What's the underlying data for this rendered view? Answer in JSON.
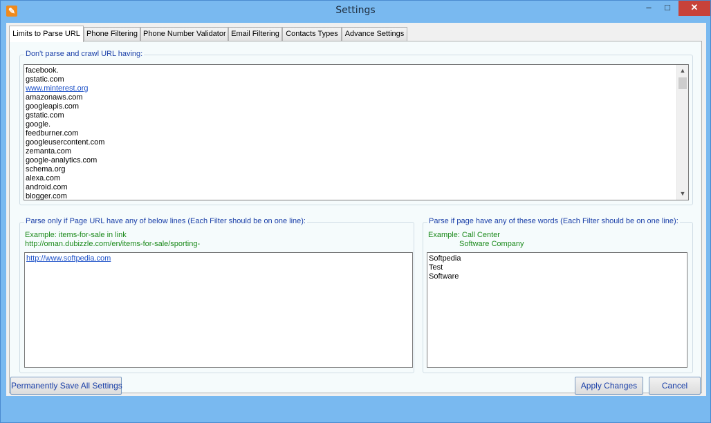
{
  "window": {
    "title": "Settings",
    "minimize_symbol": "‒",
    "maximize_symbol": "□",
    "close_symbol": "✕",
    "icon": "wrench-icon"
  },
  "tabs": [
    {
      "label": "Limits to Parse URL",
      "active": true
    },
    {
      "label": "Phone Filtering",
      "active": false
    },
    {
      "label": "Phone Number Validator",
      "active": false
    },
    {
      "label": "Email Filtering",
      "active": false
    },
    {
      "label": "Contacts Types",
      "active": false
    },
    {
      "label": "Advance Settings",
      "active": false
    }
  ],
  "dont_parse": {
    "label": "Don't parse and crawl URL having:",
    "lines": [
      "facebook.",
      "gstatic.com",
      "www.minterest.org",
      "amazonaws.com",
      "googleapis.com",
      "gstatic.com",
      "google.",
      "feedburner.com",
      "googleusercontent.com",
      "zemanta.com",
      "google-analytics.com",
      "schema.org",
      "alexa.com",
      "android.com",
      "blogger.com"
    ]
  },
  "parse_url": {
    "label": "Parse only if Page URL have any of below lines (Each Filter should be on one line):",
    "example_line1": "Example: items-for-sale in link",
    "example_line2": "http://oman.dubizzle.com/en/items-for-sale/sporting-",
    "lines": [
      "http://www.softpedia.com"
    ]
  },
  "parse_words": {
    "label": "Parse if page have any of these words (Each Filter should be on one line):",
    "example_line1": "Example: Call Center",
    "example_line2": "Software Company",
    "lines": [
      "Softpedia",
      "Test",
      "Software"
    ]
  },
  "footer": {
    "save_all": "Permanently Save All Settings",
    "apply": "Apply Changes",
    "cancel": "Cancel"
  },
  "colors": {
    "label_blue": "#1a3fa8",
    "example_green": "#1b8a1b",
    "titlebar": "#79b9f0",
    "close": "#c7423a"
  }
}
